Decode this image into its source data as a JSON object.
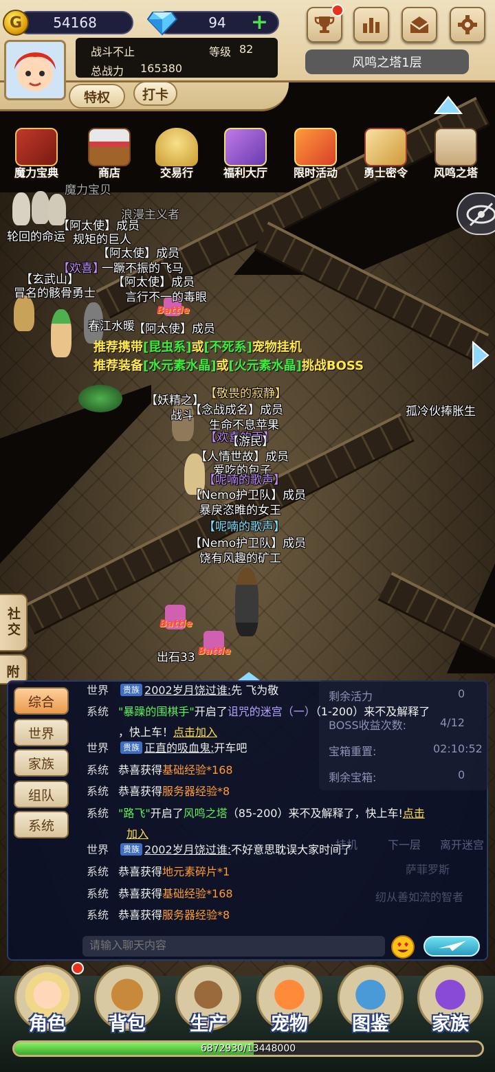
{
  "resources": {
    "gold": "54168",
    "gems": "94",
    "add_symbol": "+"
  },
  "player": {
    "name": "战斗不止",
    "level_label": "等级",
    "level": "82",
    "power_label": "总战力",
    "power": "165380"
  },
  "buttons": {
    "privilege": "特权",
    "checkin": "打卡"
  },
  "location": "风鸣之塔1层",
  "features": [
    "魔力宝典",
    "商店",
    "交易行",
    "福利大厅",
    "限时活动",
    "勇士密令",
    "风鸣之塔"
  ],
  "world_labels": {
    "l1": "轮回的命运",
    "l2": "【阿太使】成员",
    "l3": "规矩的巨人",
    "l4": "【阿太使】成员",
    "l5": "【欢喜】",
    "l6": "一蹶不振的飞马",
    "l7": "【玄武山】",
    "l8": "【阿太使】成员",
    "l9": "冒名的骸骨勇士",
    "l10": "言行不一的毒眼",
    "l11": "春江水暖",
    "l12": "【阿太使】成员",
    "l13": "【敬畏的寂静】",
    "l14": "【妖精之】",
    "l15": "【念战成名】成员",
    "l16": "生命不息苹果",
    "l17": "孤冷伙捧胀生",
    "l18": "【欢喜的雨】",
    "l19": "【游民】",
    "l20": "【人情世故】成员",
    "l21": "爱吃的包子",
    "l22": "【呢喃的歌声】",
    "l23": "【Nemo护卫队】成员",
    "l24": "暴戾恣睢的女王",
    "l25": "【呢喃的歌声】",
    "l26": "【Nemo护卫队】成员",
    "l27": "饶有风趣的矿工",
    "l28": "出石33",
    "l29": "魔力宝贝",
    "l30": "浪漫主义者",
    "l31": "战斗",
    "battle": "Battle"
  },
  "hint": {
    "line1_a": "推荐携带",
    "line1_b": "[昆虫系]",
    "line1_c": "或",
    "line1_d": "[不死系]",
    "line1_e": "宠物挂机",
    "line2_a": "推荐装备",
    "line2_b": "[水元素水晶]",
    "line2_c": "或",
    "line2_d": "[火元素水晶]",
    "line2_e": "挑战BOSS"
  },
  "side_tabs": {
    "social": "社交",
    "attach": "附"
  },
  "chat": {
    "tabs": [
      "综合",
      "世界",
      "家族",
      "组队",
      "系统"
    ],
    "messages": [
      {
        "channel": "世界",
        "badge": "贵族",
        "user": "2002岁月饶过谁:",
        "text": "先 飞为敬"
      },
      {
        "channel": "系统",
        "a": "\"暴躁的围棋手\"",
        "b": "开启了",
        "c": "诅咒的迷宫（一）",
        "d": "（1-200）来不及解释了",
        "e": "，快上车！",
        "f": "点击加入"
      },
      {
        "channel": "世界",
        "badge": "贵族",
        "user": "正直的吸血鬼:",
        "text": "开车吧"
      },
      {
        "channel": "系统",
        "a": "恭喜获得",
        "b": "基础经验*168"
      },
      {
        "channel": "系统",
        "a": "恭喜获得",
        "b": "服务器经验*8"
      },
      {
        "channel": "系统",
        "a": "\"路飞\"",
        "b": "开启了",
        "c": "风鸣之塔",
        "d": "（85-200）来不及解释了，快上车!",
        "e": "点击",
        "f": "加入"
      },
      {
        "channel": "世界",
        "badge": "贵族",
        "user": "2002岁月饶过谁:",
        "text": "不好意思耽误大家时间了"
      },
      {
        "channel": "系统",
        "a": "恭喜获得",
        "b": "地元素碎片*1"
      },
      {
        "channel": "系统",
        "a": "恭喜获得",
        "b": "基础经验*168"
      },
      {
        "channel": "系统",
        "a": "恭喜获得",
        "b": "服务器经验*8"
      }
    ],
    "input_placeholder": "请输入聊天内容"
  },
  "tower_panel": {
    "remaining_vitality_label": "剩余活力",
    "remaining_vitality": "0",
    "boss_label": "BOSS收益次数:",
    "boss_value": "4/12",
    "chest_reset_label": "宝箱重置:",
    "chest_reset_value": "02:10:52",
    "remaining_chest_label": "剩余宝箱:",
    "remaining_chest_value": "0",
    "btn_hang": "挂机",
    "btn_next": "下一层",
    "btn_leave": "离开迷宫",
    "npc1": "萨菲罗斯",
    "npc2": "纫从善如流的智者"
  },
  "bottom_nav": [
    "角色",
    "背包",
    "生产",
    "宠物",
    "图鉴",
    "家族"
  ],
  "exp": {
    "text": "6872930/13448000",
    "current": 6872930,
    "max": 13448000
  },
  "colors": {
    "accent": "#e8321c",
    "hint_yellow": "#ffe84a",
    "hint_green": "#3bef3b",
    "chat_bg": "#0a1028"
  }
}
